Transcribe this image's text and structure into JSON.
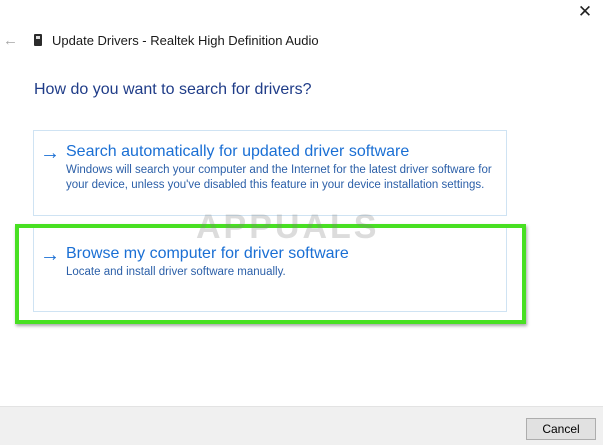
{
  "window": {
    "title": "Update Drivers - Realtek High Definition Audio",
    "close_glyph": "✕",
    "back_glyph": "←"
  },
  "main": {
    "heading": "How do you want to search for drivers?",
    "options": [
      {
        "arrow": "→",
        "title": "Search automatically for updated driver software",
        "description": "Windows will search your computer and the Internet for the latest driver software for your device, unless you've disabled this feature in your device installation settings."
      },
      {
        "arrow": "→",
        "title": "Browse my computer for driver software",
        "description": "Locate and install driver software manually."
      }
    ]
  },
  "watermark": {
    "text": "APPUALS"
  },
  "footer": {
    "cancel_label": "Cancel"
  },
  "colors": {
    "accent": "#1a6fd4",
    "heading": "#1f3c88",
    "highlight": "#48e022"
  }
}
